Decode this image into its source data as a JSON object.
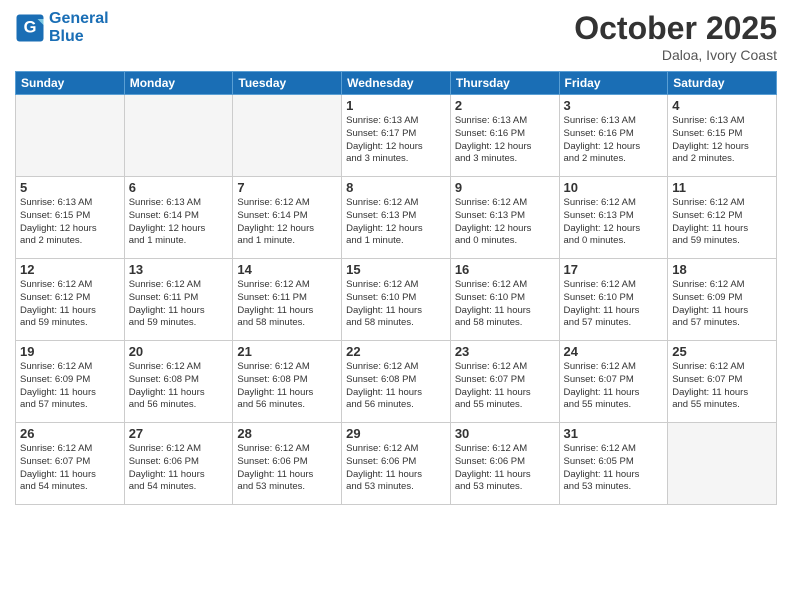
{
  "header": {
    "logo_line1": "General",
    "logo_line2": "Blue",
    "month": "October 2025",
    "location": "Daloa, Ivory Coast"
  },
  "weekdays": [
    "Sunday",
    "Monday",
    "Tuesday",
    "Wednesday",
    "Thursday",
    "Friday",
    "Saturday"
  ],
  "weeks": [
    [
      {
        "day": "",
        "info": ""
      },
      {
        "day": "",
        "info": ""
      },
      {
        "day": "",
        "info": ""
      },
      {
        "day": "1",
        "info": "Sunrise: 6:13 AM\nSunset: 6:17 PM\nDaylight: 12 hours\nand 3 minutes."
      },
      {
        "day": "2",
        "info": "Sunrise: 6:13 AM\nSunset: 6:16 PM\nDaylight: 12 hours\nand 3 minutes."
      },
      {
        "day": "3",
        "info": "Sunrise: 6:13 AM\nSunset: 6:16 PM\nDaylight: 12 hours\nand 2 minutes."
      },
      {
        "day": "4",
        "info": "Sunrise: 6:13 AM\nSunset: 6:15 PM\nDaylight: 12 hours\nand 2 minutes."
      }
    ],
    [
      {
        "day": "5",
        "info": "Sunrise: 6:13 AM\nSunset: 6:15 PM\nDaylight: 12 hours\nand 2 minutes."
      },
      {
        "day": "6",
        "info": "Sunrise: 6:13 AM\nSunset: 6:14 PM\nDaylight: 12 hours\nand 1 minute."
      },
      {
        "day": "7",
        "info": "Sunrise: 6:12 AM\nSunset: 6:14 PM\nDaylight: 12 hours\nand 1 minute."
      },
      {
        "day": "8",
        "info": "Sunrise: 6:12 AM\nSunset: 6:13 PM\nDaylight: 12 hours\nand 1 minute."
      },
      {
        "day": "9",
        "info": "Sunrise: 6:12 AM\nSunset: 6:13 PM\nDaylight: 12 hours\nand 0 minutes."
      },
      {
        "day": "10",
        "info": "Sunrise: 6:12 AM\nSunset: 6:13 PM\nDaylight: 12 hours\nand 0 minutes."
      },
      {
        "day": "11",
        "info": "Sunrise: 6:12 AM\nSunset: 6:12 PM\nDaylight: 11 hours\nand 59 minutes."
      }
    ],
    [
      {
        "day": "12",
        "info": "Sunrise: 6:12 AM\nSunset: 6:12 PM\nDaylight: 11 hours\nand 59 minutes."
      },
      {
        "day": "13",
        "info": "Sunrise: 6:12 AM\nSunset: 6:11 PM\nDaylight: 11 hours\nand 59 minutes."
      },
      {
        "day": "14",
        "info": "Sunrise: 6:12 AM\nSunset: 6:11 PM\nDaylight: 11 hours\nand 58 minutes."
      },
      {
        "day": "15",
        "info": "Sunrise: 6:12 AM\nSunset: 6:10 PM\nDaylight: 11 hours\nand 58 minutes."
      },
      {
        "day": "16",
        "info": "Sunrise: 6:12 AM\nSunset: 6:10 PM\nDaylight: 11 hours\nand 58 minutes."
      },
      {
        "day": "17",
        "info": "Sunrise: 6:12 AM\nSunset: 6:10 PM\nDaylight: 11 hours\nand 57 minutes."
      },
      {
        "day": "18",
        "info": "Sunrise: 6:12 AM\nSunset: 6:09 PM\nDaylight: 11 hours\nand 57 minutes."
      }
    ],
    [
      {
        "day": "19",
        "info": "Sunrise: 6:12 AM\nSunset: 6:09 PM\nDaylight: 11 hours\nand 57 minutes."
      },
      {
        "day": "20",
        "info": "Sunrise: 6:12 AM\nSunset: 6:08 PM\nDaylight: 11 hours\nand 56 minutes."
      },
      {
        "day": "21",
        "info": "Sunrise: 6:12 AM\nSunset: 6:08 PM\nDaylight: 11 hours\nand 56 minutes."
      },
      {
        "day": "22",
        "info": "Sunrise: 6:12 AM\nSunset: 6:08 PM\nDaylight: 11 hours\nand 56 minutes."
      },
      {
        "day": "23",
        "info": "Sunrise: 6:12 AM\nSunset: 6:07 PM\nDaylight: 11 hours\nand 55 minutes."
      },
      {
        "day": "24",
        "info": "Sunrise: 6:12 AM\nSunset: 6:07 PM\nDaylight: 11 hours\nand 55 minutes."
      },
      {
        "day": "25",
        "info": "Sunrise: 6:12 AM\nSunset: 6:07 PM\nDaylight: 11 hours\nand 55 minutes."
      }
    ],
    [
      {
        "day": "26",
        "info": "Sunrise: 6:12 AM\nSunset: 6:07 PM\nDaylight: 11 hours\nand 54 minutes."
      },
      {
        "day": "27",
        "info": "Sunrise: 6:12 AM\nSunset: 6:06 PM\nDaylight: 11 hours\nand 54 minutes."
      },
      {
        "day": "28",
        "info": "Sunrise: 6:12 AM\nSunset: 6:06 PM\nDaylight: 11 hours\nand 53 minutes."
      },
      {
        "day": "29",
        "info": "Sunrise: 6:12 AM\nSunset: 6:06 PM\nDaylight: 11 hours\nand 53 minutes."
      },
      {
        "day": "30",
        "info": "Sunrise: 6:12 AM\nSunset: 6:06 PM\nDaylight: 11 hours\nand 53 minutes."
      },
      {
        "day": "31",
        "info": "Sunrise: 6:12 AM\nSunset: 6:05 PM\nDaylight: 11 hours\nand 53 minutes."
      },
      {
        "day": "",
        "info": ""
      }
    ]
  ]
}
